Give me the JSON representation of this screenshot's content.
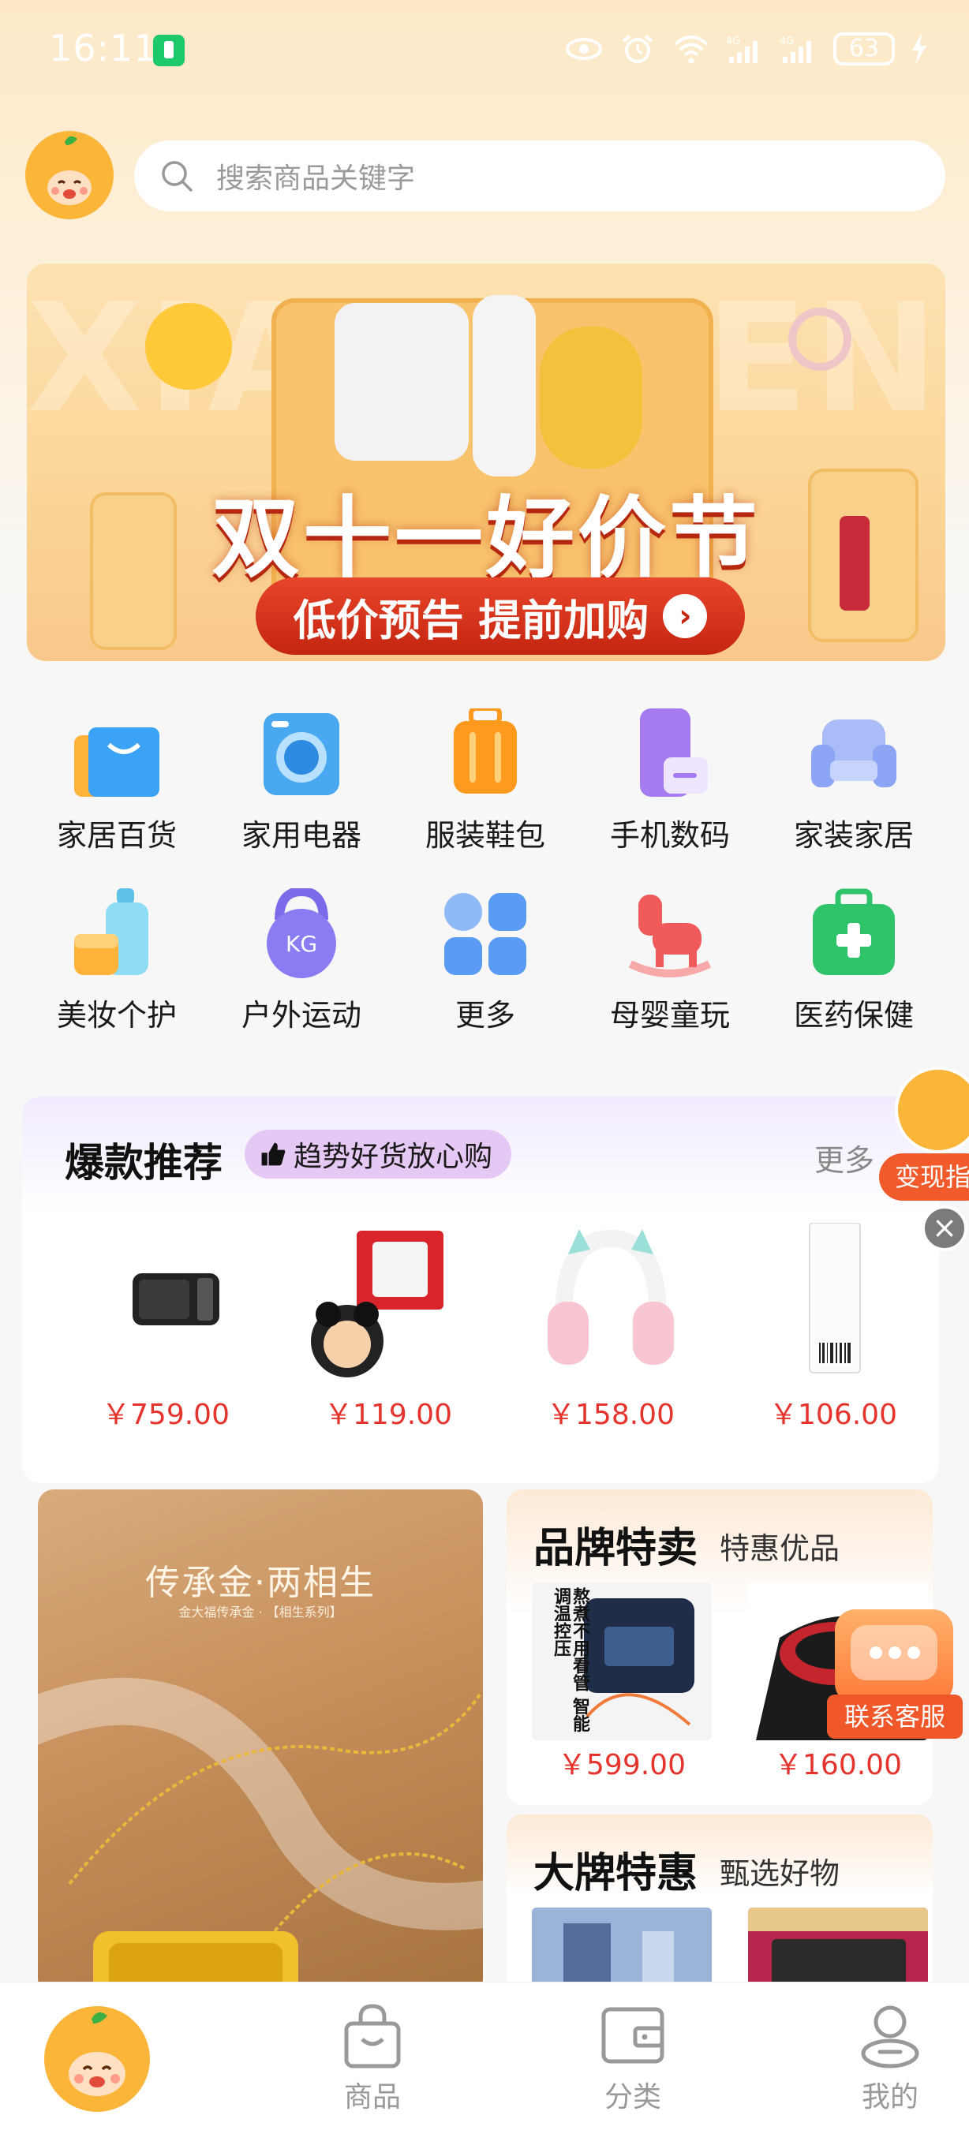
{
  "status_bar": {
    "time": "16:11",
    "battery": "63"
  },
  "search": {
    "placeholder": "搜索商品关键字"
  },
  "banner": {
    "bg_text": "XIAOCHENG",
    "title": "双十一好价节",
    "cta": "低价预告 提前加购",
    "cta_arrow": "›"
  },
  "categories": [
    {
      "label": "家居百货",
      "icon": "shopping-bag-icon",
      "color": "#3aa3f5"
    },
    {
      "label": "家用电器",
      "icon": "washing-machine-icon",
      "color": "#4aa8f0"
    },
    {
      "label": "服装鞋包",
      "icon": "suitcase-icon",
      "color": "#ff9a1f"
    },
    {
      "label": "手机数码",
      "icon": "phone-icon",
      "color": "#a77bf0"
    },
    {
      "label": "家装家居",
      "icon": "sofa-icon",
      "color": "#8ca6f5"
    },
    {
      "label": "美妆个护",
      "icon": "cosmetics-icon",
      "color": "#5fc0e8"
    },
    {
      "label": "户外运动",
      "icon": "kettlebell-icon",
      "color": "#8a7cf2"
    },
    {
      "label": "更多",
      "icon": "grid-icon",
      "color": "#5a9cf5"
    },
    {
      "label": "母婴童玩",
      "icon": "rocking-horse-icon",
      "color": "#f05a5a"
    },
    {
      "label": "医药保健",
      "icon": "medical-kit-icon",
      "color": "#2fc46a"
    }
  ],
  "hot": {
    "title": "爆款推荐",
    "tag": "趋势好货放心购",
    "more": "更多",
    "items": [
      {
        "price": "￥759.00"
      },
      {
        "price": "￥119.00"
      },
      {
        "price": "￥158.00"
      },
      {
        "price": "￥106.00"
      }
    ]
  },
  "float_promo": {
    "label": "变现指"
  },
  "float_close": "×",
  "jewel": {
    "title": "传承金·两相生",
    "subtitle": "金大福传承金 · 【相生系列】"
  },
  "brand_sale": {
    "title": "品牌特卖",
    "subtitle": "特惠优品",
    "items": [
      {
        "price": "￥599.00",
        "overlay_text": "熬煮不用看管 智能调温控压"
      },
      {
        "price": "￥160.00"
      }
    ]
  },
  "big_brand": {
    "title": "大牌特惠",
    "subtitle": "甄选好物"
  },
  "float_service": {
    "label": "联系客服"
  },
  "bottom_nav": {
    "items": [
      {
        "label": "商品"
      },
      {
        "label": "分类"
      },
      {
        "label": "我的"
      }
    ]
  },
  "colors": {
    "price_red": "#e5342d",
    "accent_orange": "#f15a2b",
    "nav_gray": "#999999"
  }
}
